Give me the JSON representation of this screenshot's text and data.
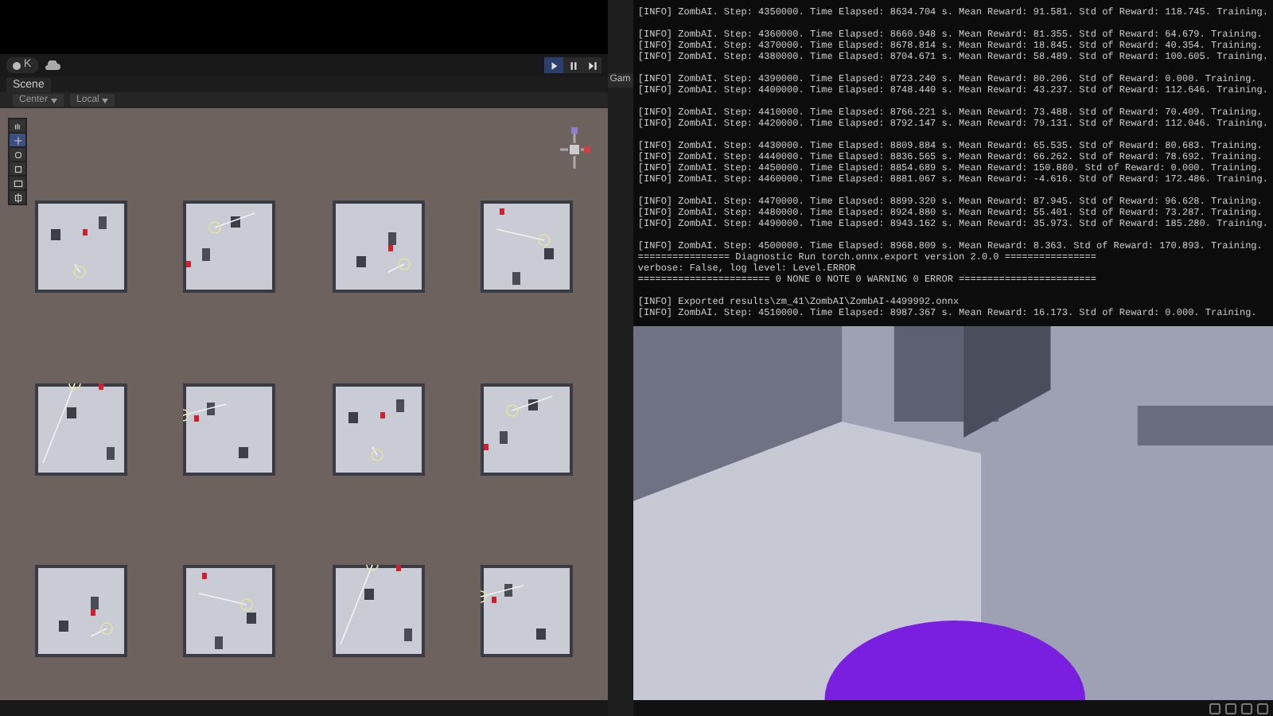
{
  "toolbar": {
    "account": "K",
    "play_controls": [
      {
        "kind": "play",
        "selected": true
      },
      {
        "kind": "pause",
        "selected": false
      },
      {
        "kind": "step",
        "selected": false
      }
    ]
  },
  "scene_panel": {
    "tab": "Scene",
    "pivot": "Center",
    "space": "Local",
    "tools": [
      {
        "kind": "hand",
        "selected": false
      },
      {
        "kind": "move",
        "selected": true
      },
      {
        "kind": "rotate",
        "selected": false
      },
      {
        "kind": "scale",
        "selected": false
      },
      {
        "kind": "rect",
        "selected": false
      },
      {
        "kind": "transform",
        "selected": false
      }
    ]
  },
  "game_panel": {
    "tab": "Gam"
  },
  "terminal": {
    "blocks": [
      [
        "[INFO] ZombAI. Step: 4350000. Time Elapsed: 8634.704 s. Mean Reward: 91.581. Std of Reward: 118.745. Training."
      ],
      [
        "[INFO] ZombAI. Step: 4360000. Time Elapsed: 8660.948 s. Mean Reward: 81.355. Std of Reward: 64.679. Training.",
        "[INFO] ZombAI. Step: 4370000. Time Elapsed: 8678.814 s. Mean Reward: 18.845. Std of Reward: 40.354. Training.",
        "[INFO] ZombAI. Step: 4380000. Time Elapsed: 8704.671 s. Mean Reward: 58.489. Std of Reward: 100.605. Training."
      ],
      [
        "[INFO] ZombAI. Step: 4390000. Time Elapsed: 8723.240 s. Mean Reward: 80.206. Std of Reward: 0.000. Training.",
        "[INFO] ZombAI. Step: 4400000. Time Elapsed: 8748.440 s. Mean Reward: 43.237. Std of Reward: 112.646. Training."
      ],
      [
        "[INFO] ZombAI. Step: 4410000. Time Elapsed: 8766.221 s. Mean Reward: 73.488. Std of Reward: 70.409. Training.",
        "[INFO] ZombAI. Step: 4420000. Time Elapsed: 8792.147 s. Mean Reward: 79.131. Std of Reward: 112.046. Training."
      ],
      [
        "[INFO] ZombAI. Step: 4430000. Time Elapsed: 8809.884 s. Mean Reward: 65.535. Std of Reward: 80.683. Training.",
        "[INFO] ZombAI. Step: 4440000. Time Elapsed: 8836.565 s. Mean Reward: 66.262. Std of Reward: 78.692. Training.",
        "[INFO] ZombAI. Step: 4450000. Time Elapsed: 8854.689 s. Mean Reward: 150.880. Std of Reward: 0.000. Training.",
        "[INFO] ZombAI. Step: 4460000. Time Elapsed: 8881.067 s. Mean Reward: -4.616. Std of Reward: 172.486. Training."
      ],
      [
        "[INFO] ZombAI. Step: 4470000. Time Elapsed: 8899.320 s. Mean Reward: 87.945. Std of Reward: 96.628. Training.",
        "[INFO] ZombAI. Step: 4480000. Time Elapsed: 8924.880 s. Mean Reward: 55.401. Std of Reward: 73.287. Training.",
        "[INFO] ZombAI. Step: 4490000. Time Elapsed: 8943.162 s. Mean Reward: 35.973. Std of Reward: 185.280. Training."
      ],
      [
        "[INFO] ZombAI. Step: 4500000. Time Elapsed: 8968.809 s. Mean Reward: 8.363. Std of Reward: 170.893. Training.",
        "================ Diagnostic Run torch.onnx.export version 2.0.0 ================",
        "verbose: False, log level: Level.ERROR",
        "======================= 0 NONE 0 NOTE 0 WARNING 0 ERROR ========================"
      ],
      [
        "[INFO] Exported results\\zm_41\\ZombAI\\ZombAI-4499992.onnx",
        "[INFO] ZombAI. Step: 4510000. Time Elapsed: 8987.367 s. Mean Reward: 16.173. Std of Reward: 0.000. Training."
      ]
    ]
  }
}
